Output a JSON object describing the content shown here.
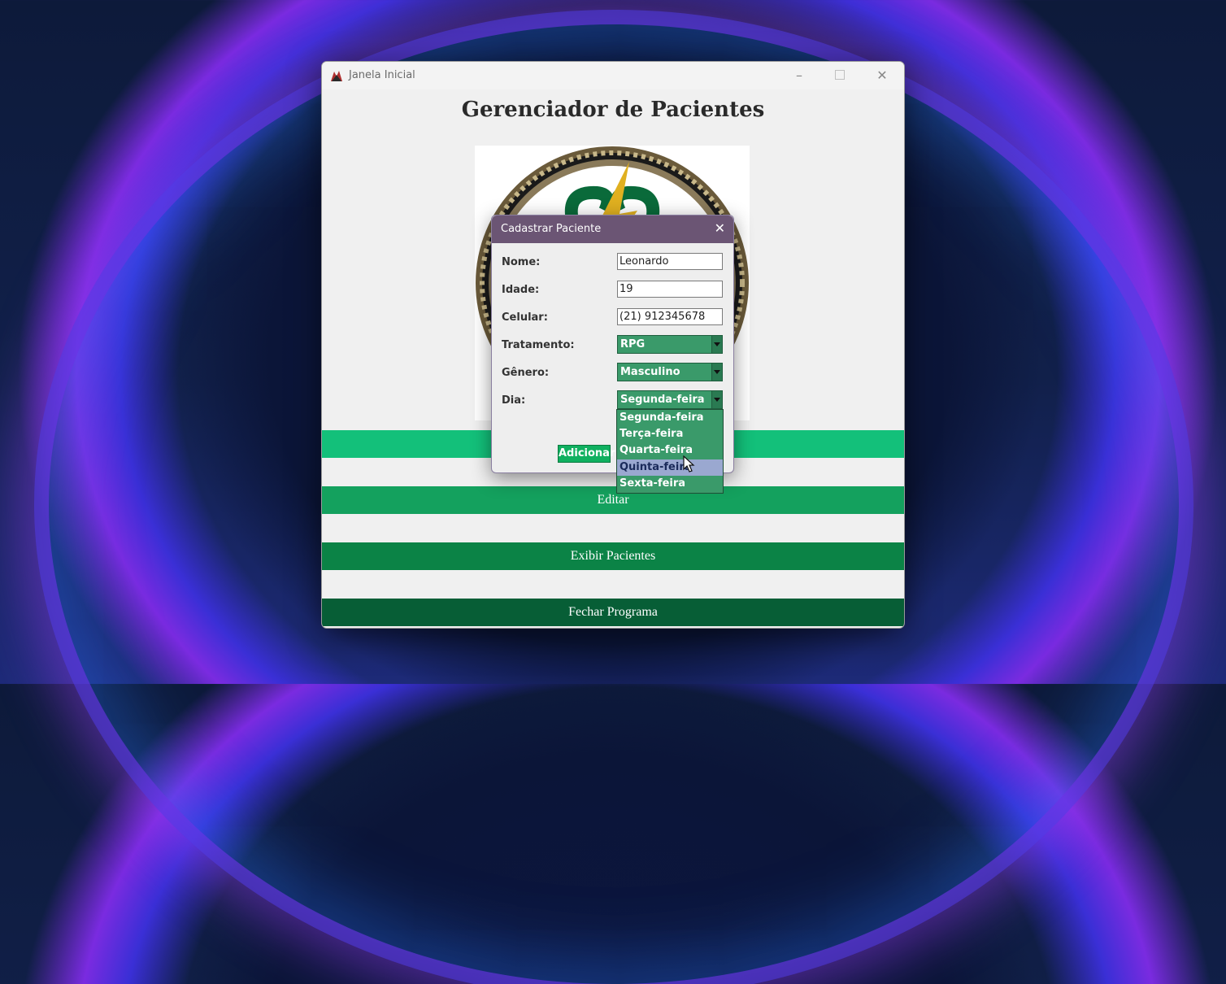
{
  "window": {
    "title": "Janela Inicial",
    "heading": "Gerenciador de Pacientes"
  },
  "main_buttons": [
    {
      "label": "",
      "color": "#13c07a"
    },
    {
      "label": "Editar",
      "color": "#14a15e"
    },
    {
      "label": "Exibir Pacientes",
      "color": "#0b8346"
    },
    {
      "label": "Fechar Programa",
      "color": "#075e36"
    }
  ],
  "dialog": {
    "title": "Cadastrar Paciente",
    "fields": {
      "nome_label": "Nome:",
      "nome_value": "Leonardo",
      "idade_label": "Idade:",
      "idade_value": "19",
      "celular_label": "Celular:",
      "celular_value": "(21) 912345678",
      "tratamento_label": "Tratamento:",
      "tratamento_value": "RPG",
      "genero_label": "Gênero:",
      "genero_value": "Masculino",
      "dia_label": "Dia:",
      "dia_value": "Segunda-feira"
    },
    "add_label": "Adicionar",
    "dia_options": [
      "Segunda-feira",
      "Terça-feira",
      "Quarta-feira",
      "Quinta-feira",
      "Sexta-feira"
    ],
    "highlighted_option": "Quinta-feira"
  }
}
